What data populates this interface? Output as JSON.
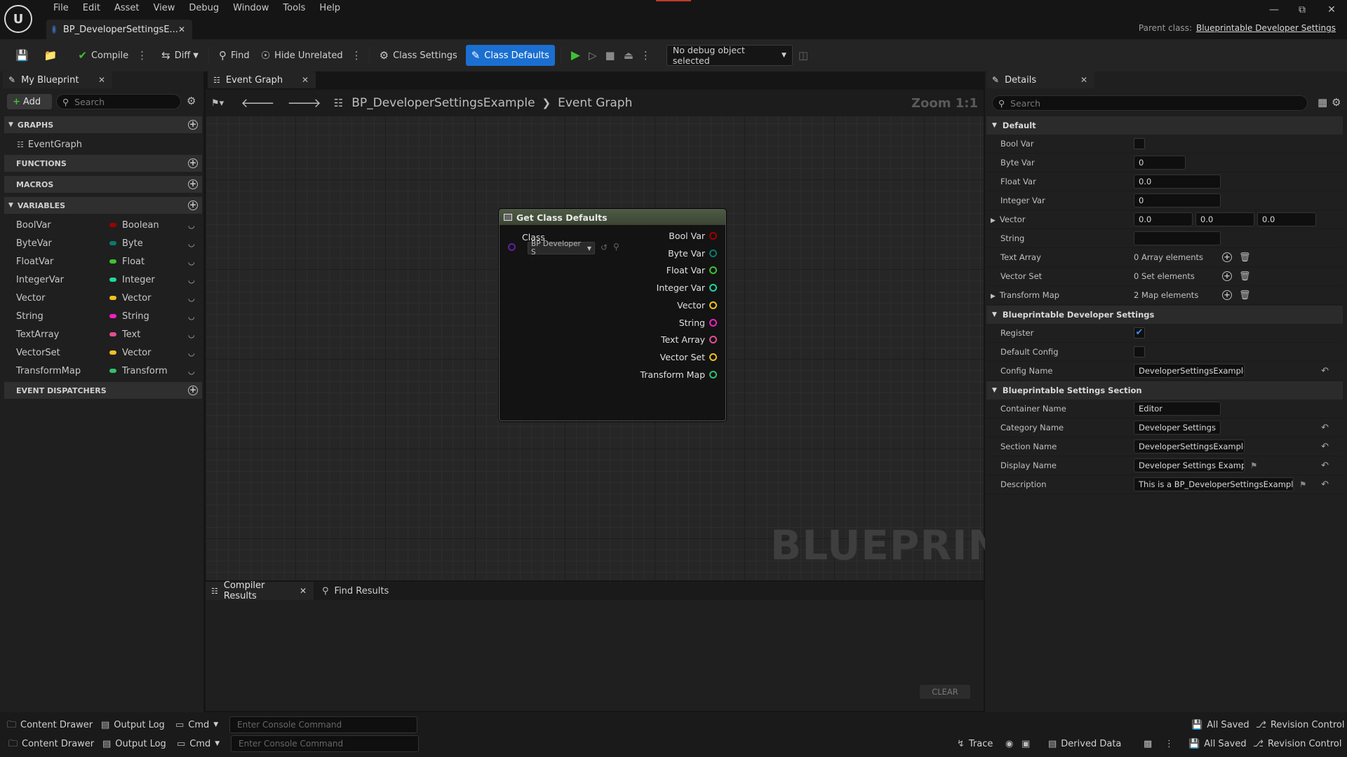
{
  "menu": [
    "File",
    "Edit",
    "Asset",
    "View",
    "Debug",
    "Window",
    "Tools",
    "Help"
  ],
  "document_tab": {
    "title": "BP_DeveloperSettingsE..."
  },
  "parent_class": {
    "label": "Parent class:",
    "value": "Blueprintable Developer Settings"
  },
  "toolbar": {
    "compile": "Compile",
    "diff": "Diff",
    "find": "Find",
    "hide_unrelated": "Hide Unrelated",
    "class_settings": "Class Settings",
    "class_defaults": "Class Defaults",
    "debug_object": "No debug object selected"
  },
  "my_blueprint": {
    "tab": "My Blueprint",
    "add": "Add",
    "search_placeholder": "Search",
    "sections": {
      "graphs": "GRAPHS",
      "functions": "FUNCTIONS",
      "macros": "MACROS",
      "variables": "VARIABLES",
      "event_dispatchers": "EVENT DISPATCHERS"
    },
    "graph_items": [
      "EventGraph"
    ],
    "variables": [
      {
        "name": "BoolVar",
        "type": "Boolean",
        "color": "#a00000"
      },
      {
        "name": "ByteVar",
        "type": "Byte",
        "color": "#0a7a6a"
      },
      {
        "name": "FloatVar",
        "type": "Float",
        "color": "#3ec232"
      },
      {
        "name": "IntegerVar",
        "type": "Integer",
        "color": "#20d7a0"
      },
      {
        "name": "Vector",
        "type": "Vector",
        "color": "#f0c020"
      },
      {
        "name": "String",
        "type": "String",
        "color": "#f020c0"
      },
      {
        "name": "TextArray",
        "type": "Text",
        "color": "#e05090"
      },
      {
        "name": "VectorSet",
        "type": "Vector",
        "color": "#f0c020"
      },
      {
        "name": "TransformMap",
        "type": "Transform",
        "color": "#30c070"
      }
    ]
  },
  "event_graph": {
    "tab": "Event Graph",
    "breadcrumb_root": "BP_DeveloperSettingsExample",
    "breadcrumb_leaf": "Event Graph",
    "zoom": "Zoom 1:1",
    "watermark": "BLUEPRINT",
    "node": {
      "title": "Get Class Defaults",
      "input_label": "Class",
      "class_value": "BP Developer S",
      "outputs": [
        {
          "label": "Bool Var",
          "color": "#a00000"
        },
        {
          "label": "Byte Var",
          "color": "#0a7a6a"
        },
        {
          "label": "Float Var",
          "color": "#3ec232"
        },
        {
          "label": "Integer Var",
          "color": "#20d7a0"
        },
        {
          "label": "Vector",
          "color": "#f0c020"
        },
        {
          "label": "String",
          "color": "#f020c0"
        },
        {
          "label": "Text Array",
          "color": "#e05090"
        },
        {
          "label": "Vector Set",
          "color": "#f0c020"
        },
        {
          "label": "Transform Map",
          "color": "#30c070"
        }
      ]
    }
  },
  "bottom_tabs": {
    "compiler_results": "Compiler Results",
    "find_results": "Find Results",
    "clear": "CLEAR"
  },
  "details": {
    "tab": "Details",
    "search_placeholder": "Search",
    "section_default": "Default",
    "bool_var": "Bool Var",
    "byte_var": "Byte Var",
    "byte_value": "0",
    "float_var": "Float Var",
    "float_value": "0.0",
    "integer_var": "Integer Var",
    "integer_value": "0",
    "vector": "Vector",
    "vector_x": "0.0",
    "vector_y": "0.0",
    "vector_z": "0.0",
    "string": "String",
    "string_value": "",
    "text_array": "Text Array",
    "text_array_value": "0 Array elements",
    "vector_set": "Vector Set",
    "vector_set_value": "0 Set elements",
    "transform_map": "Transform Map",
    "transform_map_value": "2 Map elements",
    "section_dev_settings": "Blueprintable Developer Settings",
    "register": "Register",
    "default_config": "Default Config",
    "config_name": "Config Name",
    "config_name_value": "DeveloperSettingsExample",
    "section_settings_section": "Blueprintable Settings Section",
    "container_name": "Container Name",
    "container_name_value": "Editor",
    "category_name": "Category Name",
    "category_name_value": "Developer Settings",
    "section_name": "Section Name",
    "section_name_value": "DeveloperSettingsExample",
    "display_name": "Display Name",
    "display_name_value": "Developer Settings Example",
    "description": "Description",
    "description_value": "This is a BP_DeveloperSettingsExample c"
  },
  "statusbar": {
    "content_drawer": "Content Drawer",
    "output_log": "Output Log",
    "cmd": "Cmd",
    "console_placeholder": "Enter Console Command",
    "all_saved": "All Saved",
    "revision_control": "Revision Control",
    "trace": "Trace",
    "derived_data": "Derived Data"
  }
}
